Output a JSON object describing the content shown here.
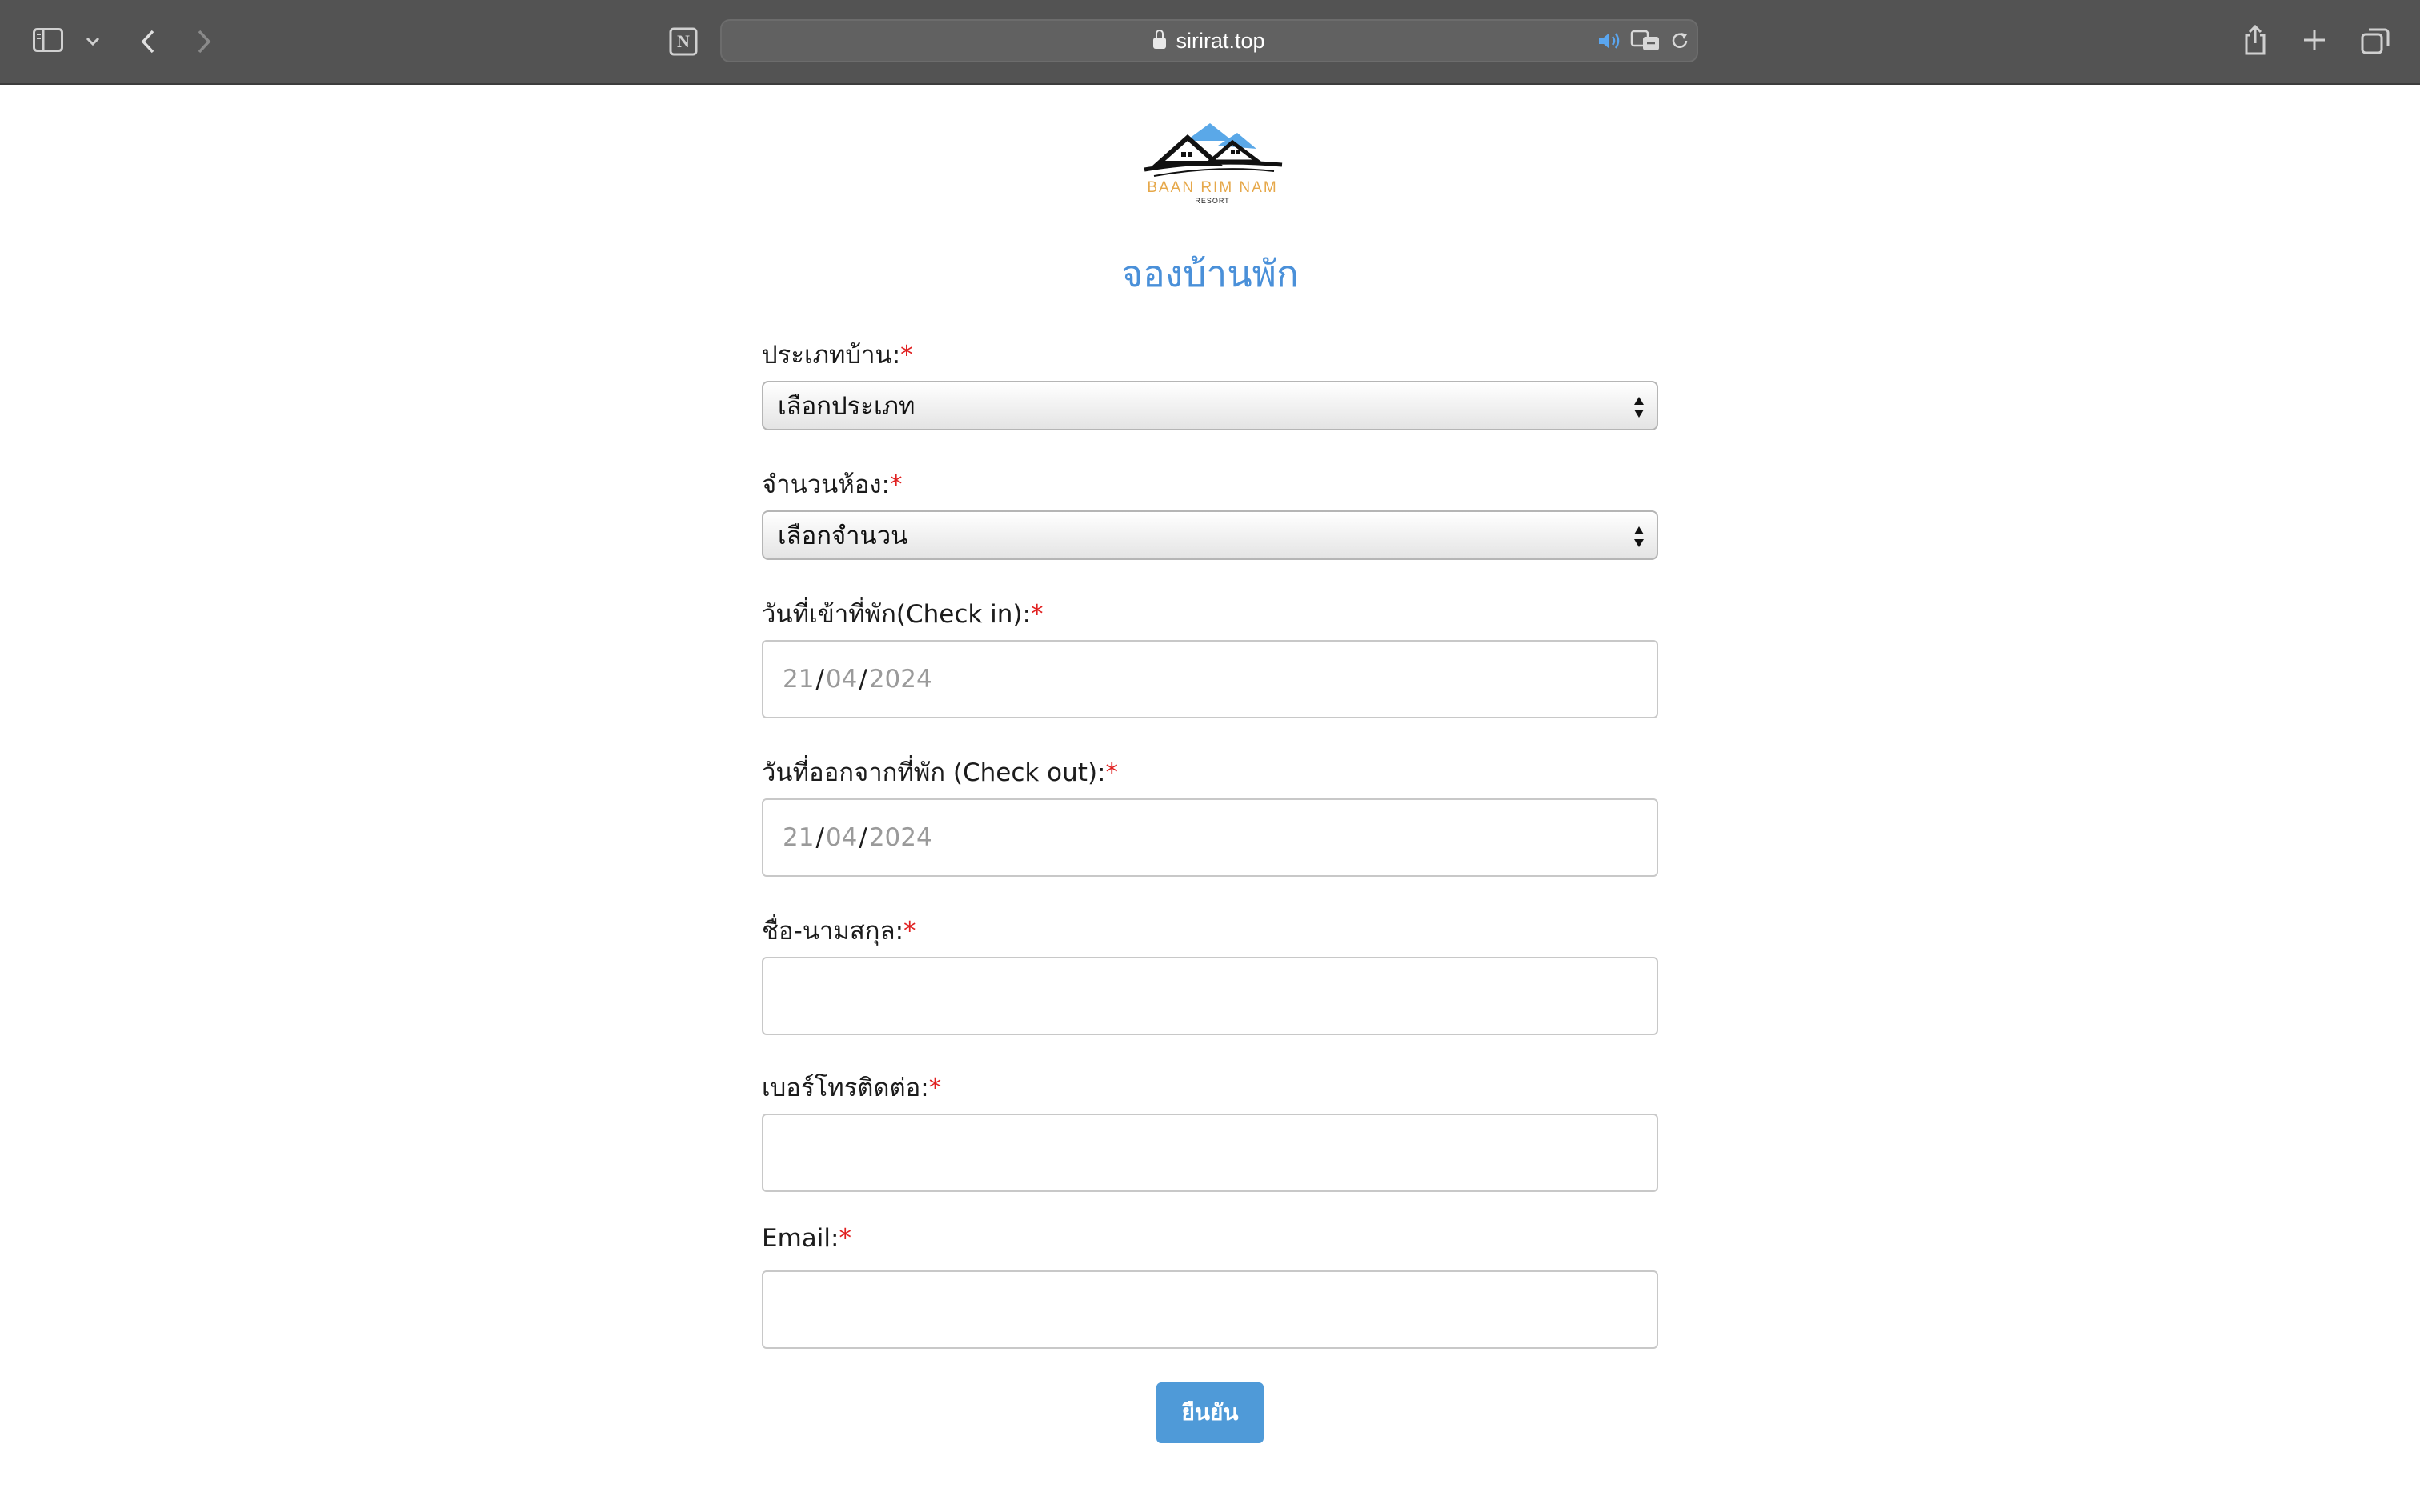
{
  "browser": {
    "url": "sirirat.top",
    "icons": {
      "sidebar": "sidebar-icon",
      "chevron": "chevron-down-icon",
      "back": "back-icon",
      "forward": "forward-icon",
      "notion": "notion-icon",
      "lock": "lock-icon",
      "audio": "speaker-icon",
      "translate": "translate-icon",
      "reload": "reload-icon",
      "share": "share-icon",
      "new_tab": "plus-icon",
      "tabs": "tabs-overview-icon"
    },
    "notion_glyph": "N"
  },
  "logo": {
    "name": "BAAN RIM NAM",
    "sub": "RESORT"
  },
  "form": {
    "title": "จองบ้านพัก",
    "required_mark": "*",
    "house_type": {
      "label": "ประเภทบ้าน:",
      "value": "เลือกประเภท"
    },
    "room_count": {
      "label": "จำนวนห้อง:",
      "value": "เลือกจำนวน"
    },
    "check_in": {
      "label": "วันที่เข้าที่พัก(Check in):",
      "day": "21",
      "month": "04",
      "year": "2024",
      "sep": "/"
    },
    "check_out": {
      "label": "วันที่ออกจากที่พัก (Check out):",
      "day": "21",
      "month": "04",
      "year": "2024",
      "sep": "/"
    },
    "full_name": {
      "label": "ชื่อ-นามสกุล:",
      "value": ""
    },
    "phone": {
      "label": "เบอร์โทรติดต่อ:",
      "value": ""
    },
    "email": {
      "label": "Email:",
      "value": ""
    },
    "submit_label": "ยืนยัน"
  },
  "colors": {
    "toolbar": "#535353",
    "title": "#4a90d9",
    "required": "#e02020",
    "button": "#4f9ad8"
  }
}
